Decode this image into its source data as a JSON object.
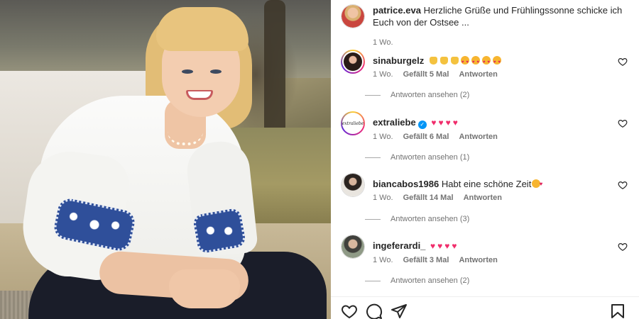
{
  "post": {
    "photo_alt_icon": "post-photo",
    "caption": {
      "username": "patrice.eva",
      "text": "Herzliche Grüße und Frühlingssonne schicke ich Euch von der Ostsee ...",
      "age": "1 Wo."
    },
    "comments": [
      {
        "username": "sinaburgelz",
        "emojis": "👏👏👏😍😍😍😍",
        "age": "1 Wo.",
        "likes": "Gefällt 5 Mal",
        "reply_label": "Antworten",
        "view_replies": "Antworten ansehen (2)"
      },
      {
        "username": "extraliebe",
        "avatar_text": "extraliebe",
        "emojis": "💗💗💗💗",
        "age": "1 Wo.",
        "likes": "Gefällt 6 Mal",
        "reply_label": "Antworten",
        "view_replies": "Antworten ansehen (1)"
      },
      {
        "username": "biancabos1986",
        "text": "Habt eine schöne Zeit",
        "emojis": "😘",
        "age": "1 Wo.",
        "likes": "Gefällt 14 Mal",
        "reply_label": "Antworten",
        "view_replies": "Antworten ansehen (3)"
      },
      {
        "username": "ingeferardi_",
        "emojis": "💗💗💗💗",
        "age": "1 Wo.",
        "likes": "Gefällt 3 Mal",
        "reply_label": "Antworten",
        "view_replies": "Antworten ansehen (2)"
      }
    ],
    "actions": {
      "like_icon": "heart-outline-icon",
      "comment_icon": "comment-bubble-icon",
      "share_icon": "paper-plane-icon",
      "save_icon": "bookmark-icon"
    }
  },
  "colors": {
    "text": "#262626",
    "secondary": "#737373",
    "verified": "#0095f6",
    "heart_emoji": "#f02d6b"
  }
}
